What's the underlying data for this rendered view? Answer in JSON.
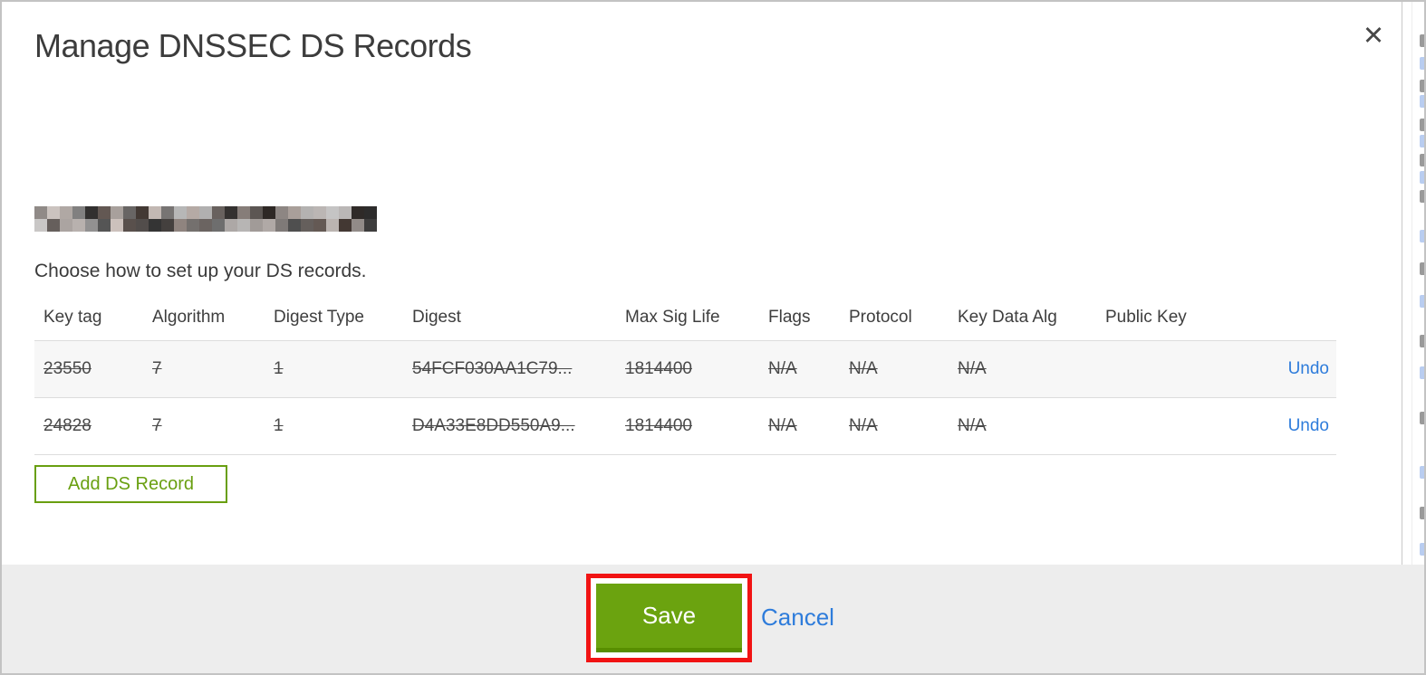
{
  "modal": {
    "title": "Manage DNSSEC DS Records",
    "close_label": "✕",
    "domain": {
      "redacted": true,
      "note": "domain name pixelated/blurred in screenshot"
    },
    "instruction": "Choose how to set up your DS records.",
    "table": {
      "headers": [
        "Key tag",
        "Algorithm",
        "Digest Type",
        "Digest",
        "Max Sig Life",
        "Flags",
        "Protocol",
        "Key Data Alg",
        "Public Key",
        ""
      ],
      "rows": [
        {
          "cells": [
            "23550",
            "7",
            "1",
            "54FCF030AA1C79...",
            "1814400",
            "N/A",
            "N/A",
            "N/A",
            ""
          ],
          "struck": true,
          "action": "Undo"
        },
        {
          "cells": [
            "24828",
            "7",
            "1",
            "D4A33E8DD550A9...",
            "1814400",
            "N/A",
            "N/A",
            "N/A",
            ""
          ],
          "struck": true,
          "action": "Undo"
        }
      ]
    },
    "add_ds_record_label": "Add DS Record",
    "footer": {
      "save_label": "Save",
      "cancel_label": "Cancel"
    }
  },
  "annotation": {
    "shape": "red-rectangle-highlight",
    "highlights": "save-button",
    "color": "#f11313"
  },
  "colors": {
    "accent_green": "#6ba30f",
    "green_shadow": "#588e01",
    "outline_green": "#699f10",
    "link_blue": "#2e7cdb",
    "footer_bg": "#ededed",
    "row_alt_bg": "#f7f7f7",
    "table_border": "#dcdcdc",
    "text_dark": "#3c3c3c",
    "annotation_red": "#f11313"
  },
  "background_sliver": {
    "description": "edge of underlying page visible at right side of modal",
    "fragment_y_positions": [
      36,
      61,
      86,
      103,
      129,
      147,
      168,
      187,
      208,
      252,
      288,
      324,
      368,
      403,
      453,
      513,
      558,
      598
    ]
  }
}
